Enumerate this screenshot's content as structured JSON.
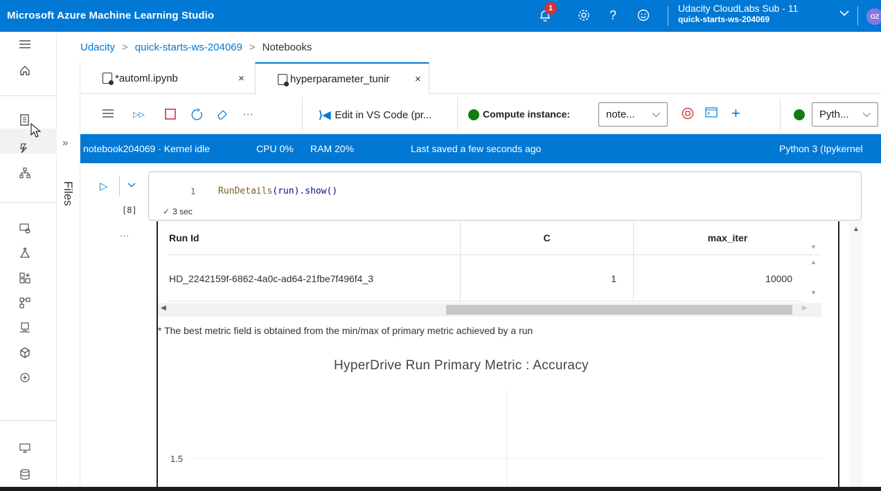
{
  "app": {
    "title": "Microsoft Azure Machine Learning Studio",
    "notification_count": "1",
    "account_name": "Udacity CloudLabs Sub - 11",
    "workspace": "quick-starts-ws-204069",
    "avatar_initials": "OZ"
  },
  "breadcrumb": [
    "Udacity",
    "quick-starts-ws-204069",
    "Notebooks"
  ],
  "files_label": "Files",
  "tabs": [
    {
      "label": "*automl.ipynb",
      "close": "×"
    },
    {
      "label": "hyperparameter_tunir",
      "close": "×"
    }
  ],
  "toolbar": {
    "vscode_label": "Edit in VS Code (pr...",
    "compute_label": "Compute instance:",
    "compute_value": "note...",
    "kernel_value": "Pyth..."
  },
  "status": {
    "kernel": "notebook204069 · Kernel idle",
    "cpu": "CPU  0%",
    "ram": "RAM 20%",
    "saved": "Last saved a few seconds ago",
    "runtime": "Python 3 (Ipykernel"
  },
  "cell": {
    "execution_count": "[8]",
    "line_number": "1",
    "code_fn": "RunDetails",
    "code_rest": "(run).show()",
    "duration": "3 sec",
    "output_prompt": "..."
  },
  "run_table": {
    "headers": [
      "Run Id",
      "C",
      "max_iter"
    ],
    "rows": [
      [
        "HD_2242159f-6862-4a0c-ad64-21fbe7f496f4_3",
        "1",
        "10000"
      ]
    ]
  },
  "note": "* The best metric field is obtained from the min/max of primary metric achieved by a run",
  "chart_data": {
    "type": "line",
    "title": "HyperDrive Run Primary Metric : Accuracy",
    "y_tick_labels": [
      "1.5"
    ],
    "series": []
  },
  "colors": {
    "brand": "#0078d4",
    "status_green": "#107c10",
    "stop_red": "#d13438"
  }
}
